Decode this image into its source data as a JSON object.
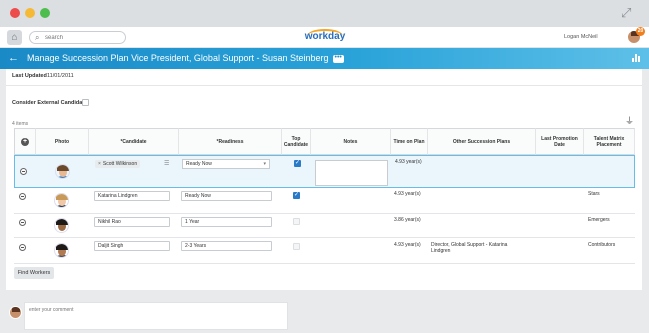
{
  "header": {
    "search_placeholder": "search",
    "logo_text": "workday",
    "user_name": "Logan McNeil",
    "notification_count": "20"
  },
  "titlebar": {
    "title": "Manage Succession Plan  Vice President, Global Support - Susan Steinberg",
    "more_label": "•••"
  },
  "form": {
    "last_updated_label": "Last Updated",
    "last_updated_value": "11/01/2011",
    "consider_external_label": "Consider External Candidate",
    "consider_external_checked": false,
    "item_count": "4 items"
  },
  "table": {
    "columns": [
      "",
      "Photo",
      "*Candidate",
      "*Readiness",
      "Top Candidate",
      "Notes",
      "Time on Plan",
      "Other Succession Plans",
      "Last Promotion Date",
      "Talent Matrix Placement"
    ],
    "rows": [
      {
        "candidate": "Scott Wilkinson",
        "readiness": "Ready Now",
        "top_candidate": true,
        "time_on_plan": "4.93 year(s)",
        "other_plans": "",
        "last_promotion": "",
        "talent_matrix": "",
        "selected": true
      },
      {
        "candidate": "Katarina Lindgren",
        "readiness": "Ready Now",
        "top_candidate": true,
        "time_on_plan": "4.93 year(s)",
        "other_plans": "",
        "last_promotion": "",
        "talent_matrix": "Stars",
        "selected": false
      },
      {
        "candidate": "Nikhil Rao",
        "readiness": "1 Year",
        "top_candidate": false,
        "time_on_plan": "3.86 year(s)",
        "other_plans": "",
        "last_promotion": "",
        "talent_matrix": "Emergers",
        "selected": false
      },
      {
        "candidate": "Daljit Singh",
        "readiness": "2-3 Years",
        "top_candidate": false,
        "time_on_plan": "4.93 year(s)",
        "other_plans": "Director, Global Support - Katarina Lindgren",
        "last_promotion": "",
        "talent_matrix": "Contributors",
        "selected": false
      }
    ]
  },
  "actions": {
    "find_workers_label": "Find Workers"
  },
  "comment": {
    "placeholder": "enter your comment"
  },
  "colors": {
    "accent_blue": "#1a8ac7",
    "selected_row": "#eaf6fc",
    "notification_orange": "#f07f1e"
  }
}
